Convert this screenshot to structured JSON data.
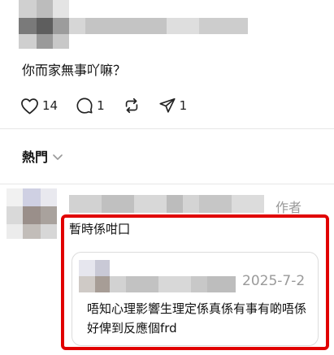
{
  "post": {
    "text": "你而家無事吖嘛？",
    "likes": "14",
    "comments": "1",
    "reposts": "",
    "shares": "1"
  },
  "sort": {
    "label": "熱門"
  },
  "reply": {
    "author_tag": "作者",
    "text": "暫時係咁囗",
    "quote": {
      "date": "2025-7-2",
      "text": "唔知心理影響生理定係真係有事有啲唔係好俾到反應個frd"
    }
  },
  "colors": {
    "highlight": "#e10000",
    "muted": "#9a9a9a",
    "divider": "#e6e6e6"
  },
  "icons": {
    "like": "heart-icon",
    "comment": "comment-bubble-icon",
    "repost": "repost-icon",
    "share": "send-icon",
    "sort_chevron": "chevron-down-icon"
  }
}
